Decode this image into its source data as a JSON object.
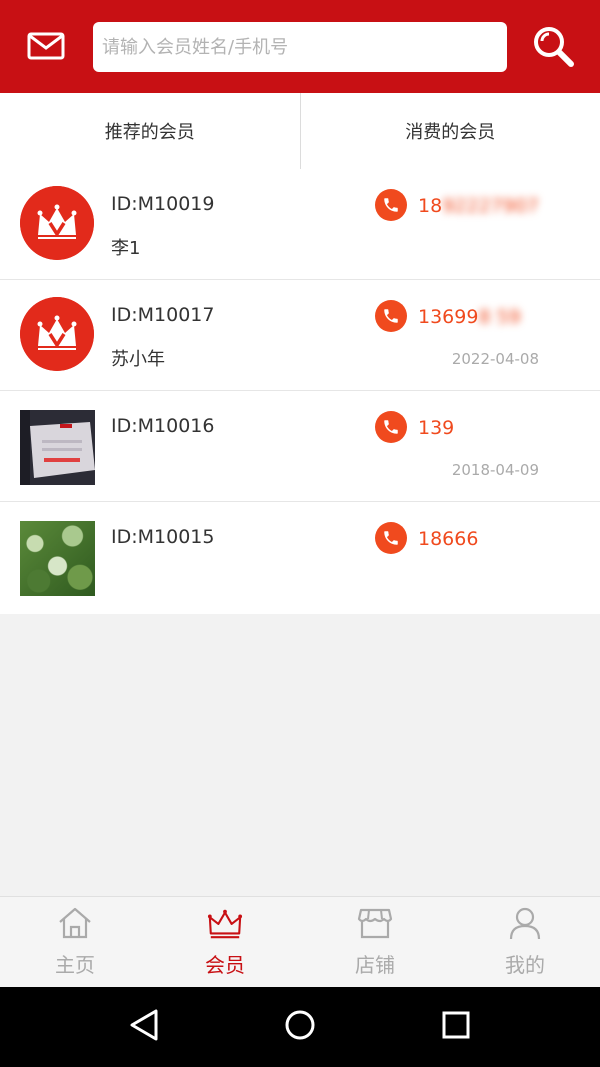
{
  "colors": {
    "brand": "#c81014",
    "phone": "#f04a1e",
    "avatar_bg": "#e22a1b"
  },
  "header": {
    "mail_icon": "mail-icon",
    "search_placeholder": "请输入会员姓名/手机号",
    "search_icon": "search-icon"
  },
  "tabs": [
    {
      "label": "推荐的会员"
    },
    {
      "label": "消费的会员"
    }
  ],
  "members": [
    {
      "id": "ID:M10019",
      "name": "李1",
      "phone_visible": "18",
      "phone_hidden": "92227907",
      "date": ""
    },
    {
      "id": "ID:M10017",
      "name": "苏小年",
      "phone_visible": "13699",
      "phone_hidden": "8 59",
      "date": "2022-04-08"
    },
    {
      "id": "ID:M10016",
      "name": "",
      "phone_visible": "139",
      "phone_hidden": "",
      "date": "2018-04-09"
    },
    {
      "id": "ID:M10015",
      "name": "",
      "phone_visible": "18666",
      "phone_hidden": "",
      "date": ""
    }
  ],
  "nav": [
    {
      "label": "主页",
      "icon": "home-icon"
    },
    {
      "label": "会员",
      "icon": "crown-icon",
      "active": true
    },
    {
      "label": "店铺",
      "icon": "store-icon"
    },
    {
      "label": "我的",
      "icon": "user-icon"
    }
  ],
  "system_bar": {
    "back": "back-icon",
    "home": "home-circle-icon",
    "recents": "recents-icon"
  }
}
